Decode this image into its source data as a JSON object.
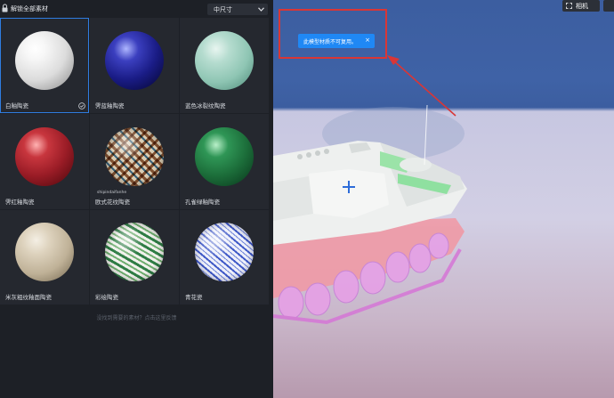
{
  "material_panel": {
    "title": "解锁全部素材",
    "size_select": {
      "selected": "中尺寸"
    },
    "materials": [
      {
        "label": "白釉陶瓷",
        "selected": true
      },
      {
        "label": "霁蓝釉陶瓷",
        "selected": false
      },
      {
        "label": "蓝色冰裂纹陶瓷",
        "selected": false
      },
      {
        "label": "霁红釉陶瓷",
        "selected": false
      },
      {
        "label": "欧式花纹陶瓷",
        "selected": false
      },
      {
        "label": "孔雀绿釉陶瓷",
        "selected": false
      },
      {
        "label": "米灰粗纹釉面陶瓷",
        "selected": false
      },
      {
        "label": "彩绘陶瓷",
        "selected": false
      },
      {
        "label": "青花瓷",
        "selected": false
      }
    ],
    "watermark": "shipindaifanhe",
    "feedback_text": "没找到需要的素材？点击这里反馈",
    "colors": {
      "selected_border": "#2f7de1",
      "panel_bg": "#1d2026",
      "tile_bg": "#25282f"
    }
  },
  "viewport": {
    "camera_button": {
      "icon": "camera-icon",
      "label": "相机"
    },
    "toast": {
      "message": "此模型材质不可复用。",
      "close_label": "×"
    },
    "colors": {
      "sky": "#3f62a6",
      "floor": "#d2cfe4",
      "toast_bg": "#1f88f5",
      "highlight": "#d93636"
    }
  }
}
